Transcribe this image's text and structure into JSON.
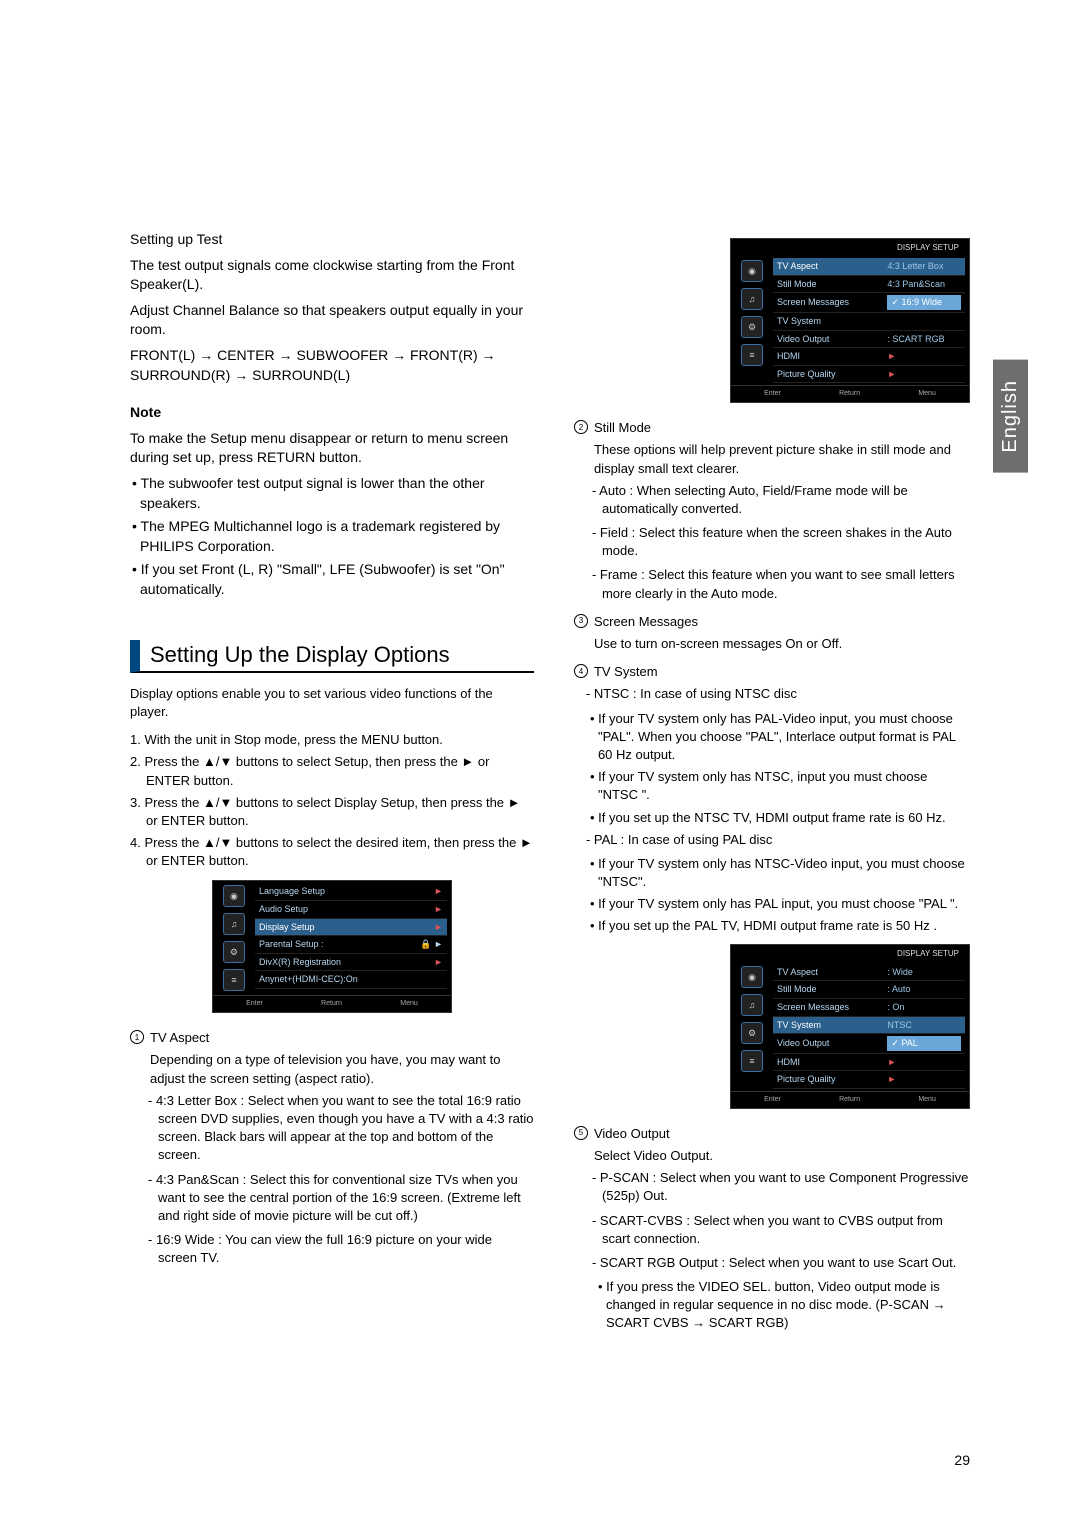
{
  "sideTab": "English",
  "pageNumber": "29",
  "leftCol": {
    "settingUpTest": "Setting up Test",
    "testOutput": "The test output signals come clockwise starting from the Front Speaker(L).",
    "adjustBalance": "Adjust Channel Balance so that speakers output equally in your room.",
    "chain": "FRONT(L) → CENTER → SUBWOOFER → FRONT(R) → SURROUND(R) → SURROUND(L)",
    "noteLabel": "Note",
    "noteText": "To make the Setup menu disappear or return to menu screen during set up, press RETURN button.",
    "bullets": [
      "The subwoofer test output signal is lower than the other speakers.",
      "The MPEG Multichannel logo is a trademark registered by PHILIPS Corporation.",
      "If you set Front (L, R) \"Small\", LFE (Subwoofer) is set \"On\" automatically."
    ],
    "sectionHeading": "Setting Up the Display Options",
    "sectionDesc": "Display options enable you to set various video functions of the player.",
    "steps": [
      "1. With the unit in Stop mode, press the MENU button.",
      "2. Press the ▲/▼ buttons to select Setup, then press the ► or ENTER button.",
      "3. Press the ▲/▼ buttons to select Display Setup, then press the ► or ENTER button.",
      "4. Press the ▲/▼ buttons to select the desired item, then press the ► or ENTER button."
    ],
    "osd1": {
      "rows": [
        {
          "label": "Language Setup",
          "hl": false
        },
        {
          "label": "Audio Setup",
          "hl": false
        },
        {
          "label": "Display Setup",
          "hl": true
        },
        {
          "label": "Parental Setup :",
          "hl": false,
          "lock": true
        },
        {
          "label": "DivX(R) Registration",
          "hl": false
        },
        {
          "label": "Anynet+(HDMI-CEC):On",
          "hl": false
        }
      ],
      "footer": [
        "Enter",
        "Return",
        "Menu"
      ]
    },
    "tvAspect": {
      "num": "1",
      "title": "TV Aspect",
      "desc": "Depending on a type of television you have, you may want to adjust the screen setting (aspect ratio).",
      "opts": [
        "- 4:3 Letter Box : Select when you want to see the total 16:9 ratio screen DVD supplies, even though you have a TV with a 4:3 ratio screen. Black bars will appear at the top and bottom of the screen.",
        "- 4:3 Pan&Scan : Select this for conventional size TVs when you want to see the central portion of the 16:9 screen. (Extreme left and right side of movie picture will be cut off.)",
        "- 16:9 Wide : You can view the full 16:9 picture on your wide screen TV."
      ]
    }
  },
  "rightCol": {
    "osd2": {
      "title": "DISPLAY SETUP",
      "rows": [
        {
          "label": "TV Aspect",
          "val": "4:3 Letter Box",
          "hlval": false,
          "hlrow": true
        },
        {
          "label": "Still Mode",
          "val": "4:3 Pan&Scan",
          "sub": true
        },
        {
          "label": "Screen Messages",
          "val": "✓ 16:9 Wide",
          "sub": true,
          "hlval": true
        },
        {
          "label": "TV System",
          "val": ""
        },
        {
          "label": "Video Output",
          "val": ": SCART RGB"
        },
        {
          "label": "HDMI",
          "val": "►"
        },
        {
          "label": "Picture Quality",
          "val": "►"
        }
      ],
      "footer": [
        "Enter",
        "Return",
        "Menu"
      ]
    },
    "stillMode": {
      "num": "2",
      "title": "Still Mode",
      "desc": "These options will help prevent picture shake in still mode and display small text clearer.",
      "opts": [
        "- Auto : When selecting Auto, Field/Frame mode will be automatically converted.",
        "- Field : Select this feature when the screen shakes in the Auto mode.",
        "- Frame : Select this feature when you want to see small letters more clearly in the Auto mode."
      ]
    },
    "screenMsg": {
      "num": "3",
      "title": "Screen Messages",
      "desc": "Use to turn on-screen messages On or Off."
    },
    "tvSystem": {
      "num": "4",
      "title": "TV System",
      "ntsc": "- NTSC : In case of using NTSC disc",
      "ntscBullets": [
        "If your TV system only has PAL-Video input, you must choose \"PAL\". When you choose \"PAL\", Interlace output format is PAL 60 Hz output.",
        "If your TV system only has NTSC, input you must choose \"NTSC \".",
        "If you set up the NTSC TV, HDMI output frame rate is 60 Hz."
      ],
      "pal": "- PAL : In case of using PAL disc",
      "palBullets": [
        "If your TV system only has NTSC-Video input, you must choose \"NTSC\".",
        "If your TV system only has PAL input, you must choose \"PAL \".",
        "If you set up the PAL TV, HDMI output frame rate is 50 Hz ."
      ]
    },
    "osd3": {
      "title": "DISPLAY SETUP",
      "rows": [
        {
          "label": "TV Aspect",
          "val": ": Wide"
        },
        {
          "label": "Still Mode",
          "val": ": Auto"
        },
        {
          "label": "Screen Messages",
          "val": ": On"
        },
        {
          "label": "TV System",
          "val": "NTSC",
          "hlrow": true,
          "sub": true
        },
        {
          "label": "Video Output",
          "val": "✓ PAL",
          "hlval": true
        },
        {
          "label": "HDMI",
          "val": "►"
        },
        {
          "label": "Picture Quality",
          "val": "►"
        }
      ],
      "footer": [
        "Enter",
        "Return",
        "Menu"
      ]
    },
    "videoOutput": {
      "num": "5",
      "title": "Video Output",
      "desc": "Select Video Output.",
      "opts": [
        "- P-SCAN : Select when you want to use Component Progressive (525p) Out.",
        "- SCART-CVBS : Select when you want to CVBS output from scart connection.",
        "- SCART RGB Output : Select when you want to use Scart Out."
      ],
      "sub": "If you press the VIDEO SEL. button, Video output mode is changed in regular sequence in no disc mode. (P-SCAN → SCART CVBS → SCART RGB)"
    }
  }
}
